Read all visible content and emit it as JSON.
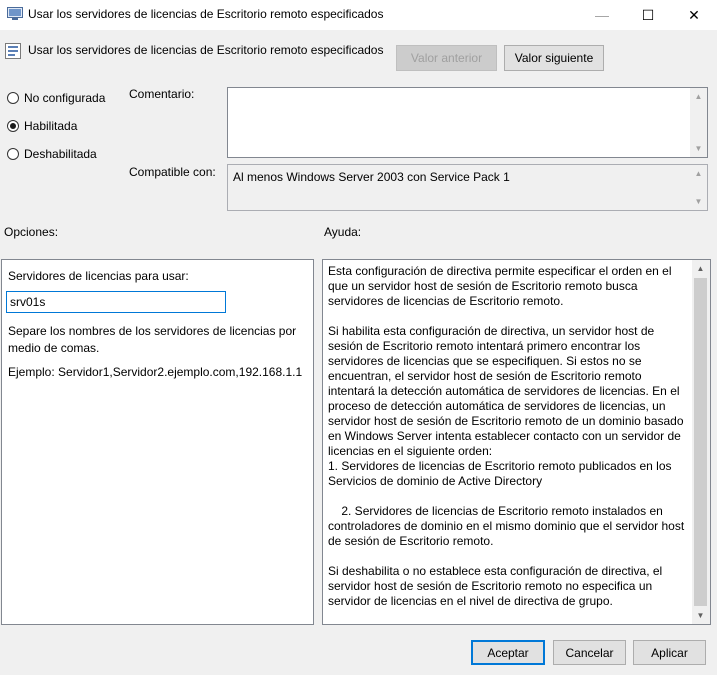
{
  "window": {
    "title": "Usar los servidores de licencias de Escritorio remoto especificados",
    "minimize_glyph": "—",
    "maximize_glyph": "☐",
    "close_glyph": "✕"
  },
  "header": {
    "policy_name": "Usar los servidores de licencias de Escritorio remoto especificados",
    "prev_button": "Valor anterior",
    "next_button": "Valor siguiente"
  },
  "state": {
    "options": [
      {
        "label": "No configurada",
        "checked": false
      },
      {
        "label": "Habilitada",
        "checked": true
      },
      {
        "label": "Deshabilitada",
        "checked": false
      }
    ]
  },
  "comment": {
    "label": "Comentario:",
    "value": ""
  },
  "compatible": {
    "label": "Compatible con:",
    "value": "Al menos Windows Server 2003 con Service Pack 1"
  },
  "options_section": {
    "heading": "Opciones:",
    "field_label": "Servidores de licencias para usar:",
    "field_value": "srv01s",
    "hint": "Separe los nombres de los servidores de licencias por medio de comas.",
    "example": "Ejemplo: Servidor1,Servidor2.ejemplo.com,192.168.1.1"
  },
  "help_section": {
    "heading": "Ayuda:",
    "paragraphs": [
      "Esta configuración de directiva permite especificar el orden en el que un servidor host de sesión de Escritorio remoto busca servidores de licencias de Escritorio remoto.",
      "Si habilita esta configuración de directiva, un servidor host de sesión de Escritorio remoto intentará primero encontrar los servidores de licencias que se especifiquen. Si estos no se encuentran, el servidor host de sesión de Escritorio remoto intentará la detección automática de servidores de licencias. En el proceso de detección automática de servidores de licencias, un servidor host de sesión de Escritorio remoto de un dominio basado en Windows Server intenta establecer contacto con un servidor de licencias en el siguiente orden:\n1. Servidores de licencias de Escritorio remoto publicados en los Servicios de dominio de Active Directory",
      "    2. Servidores de licencias de Escritorio remoto instalados en controladores de dominio en el mismo dominio que el servidor host de sesión de Escritorio remoto.",
      "Si deshabilita o no establece esta configuración de directiva, el servidor host de sesión de Escritorio remoto no especifica un servidor de licencias en el nivel de directiva de grupo."
    ]
  },
  "footer": {
    "ok": "Aceptar",
    "cancel": "Cancelar",
    "apply": "Aplicar"
  },
  "colors": {
    "window_bg": "#f0f0f0",
    "accent": "#0078d7"
  }
}
